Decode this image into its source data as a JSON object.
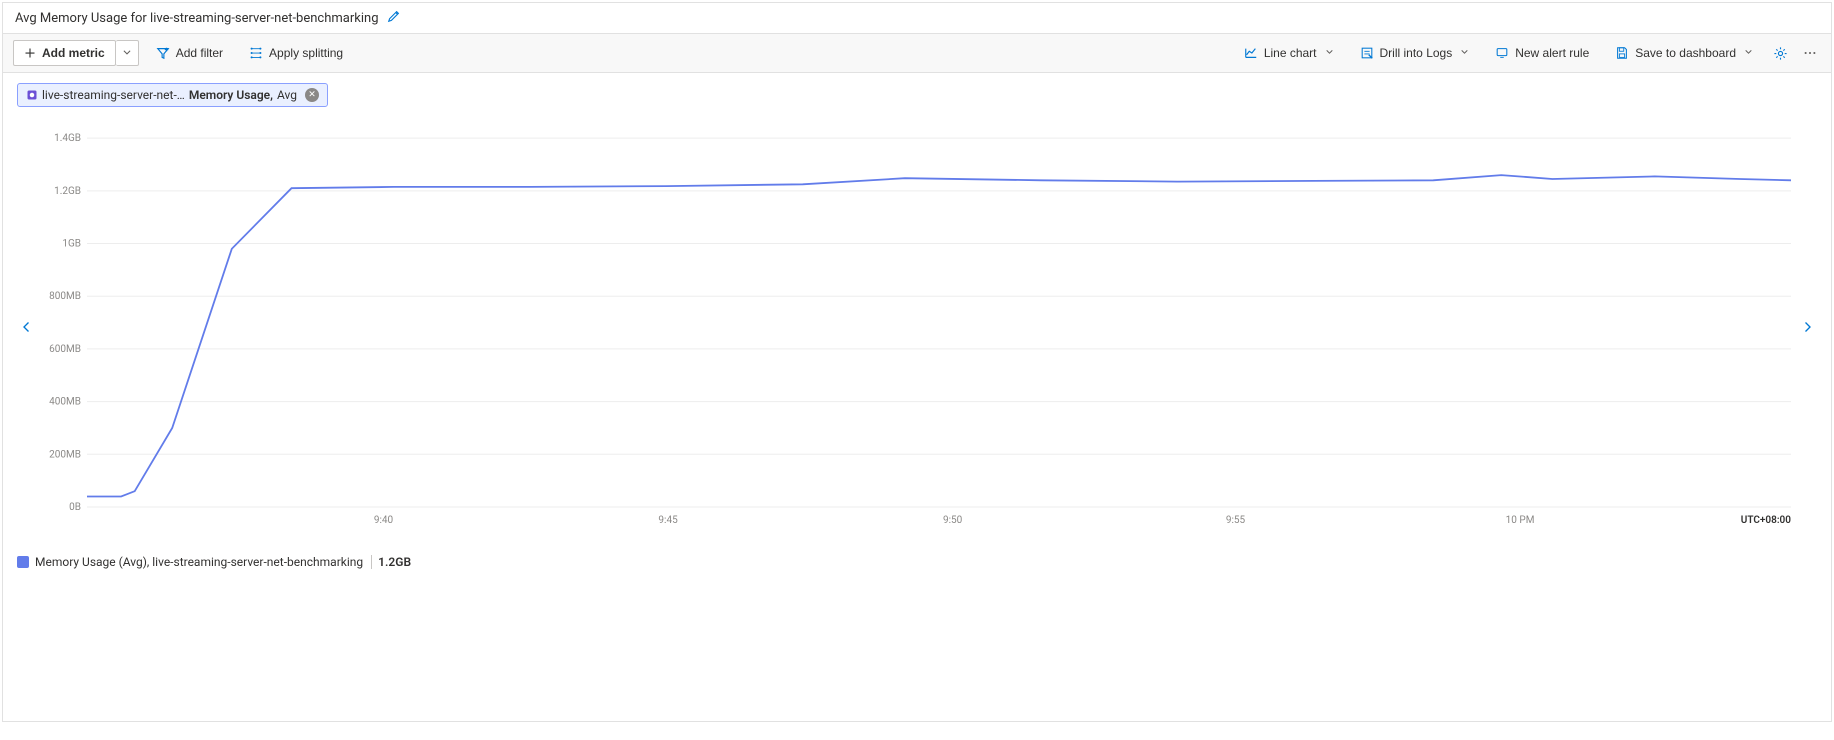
{
  "title": "Avg Memory Usage for live-streaming-server-net-benchmarking",
  "toolbar": {
    "add_metric": "Add metric",
    "add_filter": "Add filter",
    "apply_splitting": "Apply splitting",
    "line_chart": "Line chart",
    "drill_logs": "Drill into Logs",
    "new_alert": "New alert rule",
    "save_dashboard": "Save to dashboard"
  },
  "colors": {
    "series": "#627cea",
    "link": "#0078d4"
  },
  "pill": {
    "resource": "live-streaming-server-net-…",
    "metric": "Memory Usage,",
    "agg": "Avg"
  },
  "legend": {
    "label": "Memory Usage (Avg), live-streaming-server-net-benchmarking",
    "value": "1.2GB"
  },
  "x_suffix": "UTC+08:00",
  "chart_data": {
    "type": "line",
    "title": "Avg Memory Usage for live-streaming-server-net-benchmarking",
    "y_ticks": [
      {
        "v": 0,
        "label": "0B"
      },
      {
        "v": 200,
        "label": "200MB"
      },
      {
        "v": 400,
        "label": "400MB"
      },
      {
        "v": 600,
        "label": "600MB"
      },
      {
        "v": 800,
        "label": "800MB"
      },
      {
        "v": 1000,
        "label": "1GB"
      },
      {
        "v": 1200,
        "label": "1.2GB"
      },
      {
        "v": 1400,
        "label": "1.4GB"
      }
    ],
    "ylim": [
      0,
      1450
    ],
    "x_labels": [
      {
        "t": 0.174,
        "label": "9:40"
      },
      {
        "t": 0.341,
        "label": "9:45"
      },
      {
        "t": 0.508,
        "label": "9:50"
      },
      {
        "t": 0.674,
        "label": "9:55"
      },
      {
        "t": 0.841,
        "label": "10 PM"
      }
    ],
    "series": [
      {
        "name": "Memory Usage (Avg)",
        "points": [
          {
            "t": 0.0,
            "v": 40
          },
          {
            "t": 0.02,
            "v": 40
          },
          {
            "t": 0.028,
            "v": 60
          },
          {
            "t": 0.05,
            "v": 300
          },
          {
            "t": 0.085,
            "v": 980
          },
          {
            "t": 0.12,
            "v": 1210
          },
          {
            "t": 0.18,
            "v": 1215
          },
          {
            "t": 0.26,
            "v": 1215
          },
          {
            "t": 0.34,
            "v": 1218
          },
          {
            "t": 0.42,
            "v": 1225
          },
          {
            "t": 0.48,
            "v": 1248
          },
          {
            "t": 0.56,
            "v": 1240
          },
          {
            "t": 0.64,
            "v": 1235
          },
          {
            "t": 0.72,
            "v": 1238
          },
          {
            "t": 0.79,
            "v": 1240
          },
          {
            "t": 0.83,
            "v": 1260
          },
          {
            "t": 0.86,
            "v": 1245
          },
          {
            "t": 0.92,
            "v": 1255
          },
          {
            "t": 0.97,
            "v": 1245
          },
          {
            "t": 1.0,
            "v": 1240
          }
        ]
      }
    ]
  }
}
